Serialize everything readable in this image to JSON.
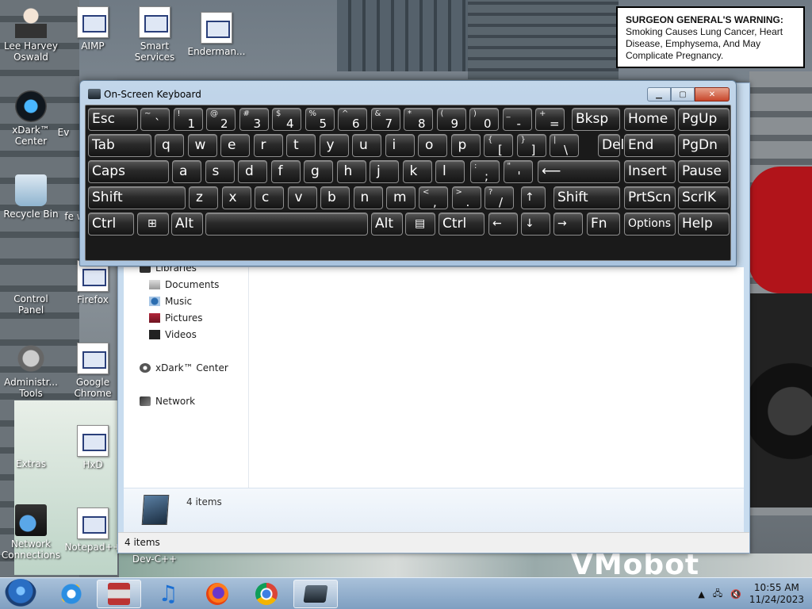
{
  "warning": {
    "lead": "SURGEON GENERAL'S WARNING:",
    "text": "Smoking Causes Lung Cancer, Heart Disease, Emphysema, And May Complicate Pregnancy."
  },
  "wallpaper_text": "VMobot",
  "desktop_icons": [
    {
      "label": "Lee Harvey Oswald"
    },
    {
      "label": "AIMP"
    },
    {
      "label": "Smart Services"
    },
    {
      "label": "Enderman..."
    },
    {
      "label": "xDark™ Center"
    },
    {
      "label": "Ev"
    },
    {
      "label": "Recycle Bin"
    },
    {
      "label": "fe w"
    },
    {
      "label": "Control Panel"
    },
    {
      "label": "Firefox"
    },
    {
      "label": "Administr... Tools"
    },
    {
      "label": "Google Chrome"
    },
    {
      "label": "Extras"
    },
    {
      "label": "HxD"
    },
    {
      "label": "Network Connections"
    },
    {
      "label": "Notepad++"
    },
    {
      "label": "Dev-C++"
    }
  ],
  "explorer": {
    "nav": [
      "Libraries",
      "Documents",
      "Music",
      "Pictures",
      "Videos",
      "xDark™ Center",
      "Network"
    ],
    "details_count": "4 items",
    "status_count": "4 items"
  },
  "osk": {
    "title": "On-Screen Keyboard",
    "buttons": {
      "minimize": "▁",
      "maximize": "▢",
      "close": "✕"
    },
    "keys": {
      "esc": "Esc",
      "bksp": "Bksp",
      "home": "Home",
      "pgup": "PgUp",
      "tab": "Tab",
      "del": "Del",
      "end": "End",
      "pgdn": "PgDn",
      "caps": "Caps",
      "insert": "Insert",
      "pause": "Pause",
      "shift_l": "Shift",
      "shift_r": "Shift",
      "prtscn": "PrtScn",
      "scrlk": "ScrlK",
      "ctrl_l": "Ctrl",
      "alt_l": "Alt",
      "alt_r": "Alt",
      "ctrl_r": "Ctrl",
      "fn": "Fn",
      "options": "Options",
      "help": "Help",
      "row1": [
        [
          "~",
          "`"
        ],
        [
          "!",
          "1"
        ],
        [
          "@",
          "2"
        ],
        [
          "#",
          "3"
        ],
        [
          "$",
          "4"
        ],
        [
          "%",
          "5"
        ],
        [
          "^",
          "6"
        ],
        [
          "&",
          "7"
        ],
        [
          "*",
          "8"
        ],
        [
          "(",
          "9"
        ],
        [
          ")",
          "0"
        ],
        [
          "_",
          "-"
        ],
        [
          "+",
          "="
        ]
      ],
      "row2": [
        "q",
        "w",
        "e",
        "r",
        "t",
        "y",
        "u",
        "i",
        "o",
        "p"
      ],
      "row2_brackets": [
        [
          "{",
          "["
        ],
        [
          "}",
          "]"
        ],
        [
          "|",
          "\\"
        ]
      ],
      "row3": [
        "a",
        "s",
        "d",
        "f",
        "g",
        "h",
        "j",
        "k",
        "l"
      ],
      "row3_punct": [
        [
          ":",
          ";"
        ],
        [
          "\"",
          "'"
        ]
      ],
      "row4": [
        "z",
        "x",
        "c",
        "v",
        "b",
        "n",
        "m"
      ],
      "row4_punct": [
        [
          "<",
          ","
        ],
        [
          ">",
          "."
        ],
        [
          "?",
          "/"
        ]
      ],
      "up": "↑",
      "left": "←",
      "down": "↓",
      "right": "→",
      "enter": "⟵"
    }
  },
  "taskbar": {
    "time": "10:55 AM",
    "date": "11/24/2023",
    "show_hidden": "▲"
  }
}
